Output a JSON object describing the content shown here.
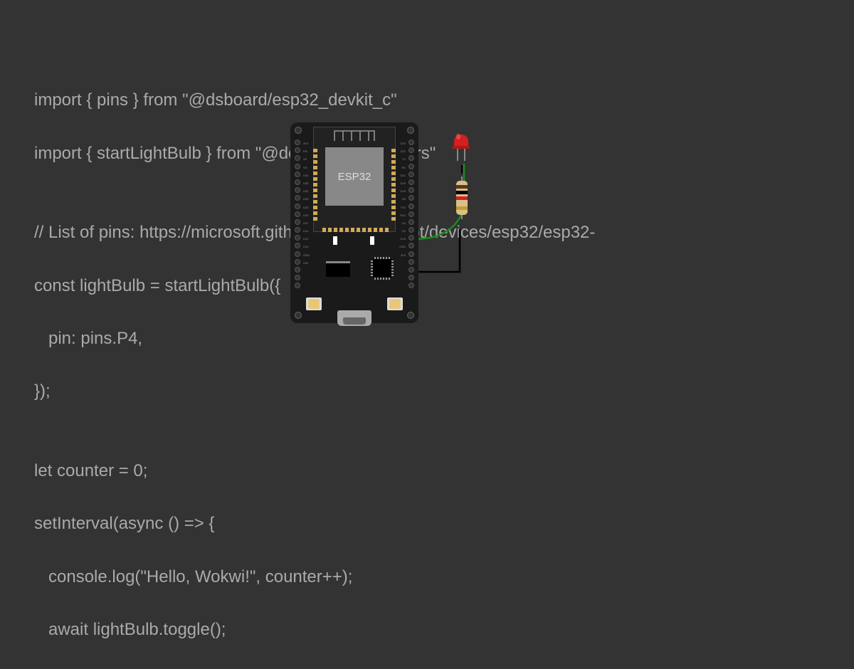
{
  "code": {
    "line1": "import { pins } from \"@dsboard/esp32_devkit_c\"",
    "line2": "import { startLightBulb } from \"@devicescript/servers\"",
    "line3": "",
    "line4": "// List of pins: https://microsoft.github.io/devicescript/devices/esp32/esp32-",
    "line5": "const lightBulb = startLightBulb({",
    "line6": "   pin: pins.P4,",
    "line7": "});",
    "line8": "",
    "line9": "let counter = 0;",
    "line10": "setInterval(async () => {",
    "line11": "   console.log(\"Hello, Wokwi!\", counter++);",
    "line12": "   await lightBulb.toggle();"
  },
  "board": {
    "chip_label": "ESP32",
    "pins_left": [
      "3V3",
      "EN",
      "VP",
      "VN",
      "D34",
      "D35",
      "D32",
      "D33",
      "D25",
      "D26",
      "D27",
      "D14",
      "D12",
      "D13",
      "GND",
      "VIN"
    ],
    "pins_right": [
      "D23",
      "D22",
      "TX",
      "RX",
      "D21",
      "D19",
      "D18",
      "D5",
      "TX2",
      "RX2",
      "D4",
      "D2",
      "D15",
      "GND",
      "3V3"
    ]
  },
  "components": {
    "led": {
      "color": "#d42020",
      "name": "led"
    },
    "resistor": {
      "bands": [
        "brown",
        "black",
        "red",
        "gold"
      ],
      "value_hint": "1k"
    }
  },
  "wires": [
    {
      "from": "D4",
      "to": "led-anode",
      "color": "#1a8a1a"
    },
    {
      "from": "GND",
      "to": "resistor-bottom",
      "color": "#000000"
    }
  ]
}
